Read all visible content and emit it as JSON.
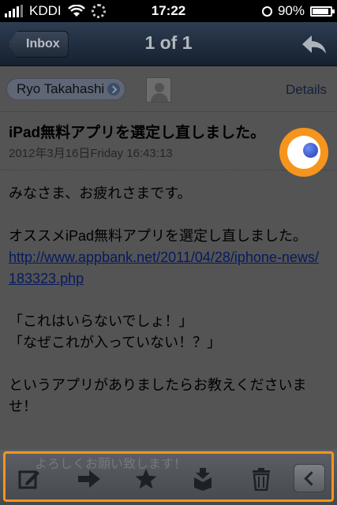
{
  "status_bar": {
    "carrier": "KDDI",
    "time": "17:22",
    "battery_percent_label": "90%",
    "battery_level": 0.9,
    "signal_bars": 4
  },
  "nav": {
    "back_label": "Inbox",
    "title": "1 of 1",
    "reply_icon": "reply-arrow-icon"
  },
  "message": {
    "sender": "Ryo Takahashi",
    "details_label": "Details",
    "subject": "iPad無料アプリを選定し直しました。",
    "date": "2012年3月16日Friday 16:43:13",
    "body": {
      "greeting": "みなさま、お疲れさまです。",
      "intro": "オススメiPad無料アプリを選定し直しました。",
      "link_text": "http://www.appbank.net/2011/04/28/iphone-news/183323.php",
      "quote1": "「これはいらないでしょ！」",
      "quote2": "「なぜこれが入っていない！？」",
      "closing": "というアプリがありましたらお教えくださいませ！",
      "faded_line": "よろしくお願い致します！"
    }
  },
  "toolbar": {
    "icons": [
      "compose-icon",
      "forward-arrow-icon",
      "star-icon",
      "move-to-folder-icon",
      "trash-icon",
      "back-chevron-icon"
    ]
  },
  "colors": {
    "highlight_orange": "#f7941d",
    "unread_dot_blue": "#2a4bd0"
  }
}
